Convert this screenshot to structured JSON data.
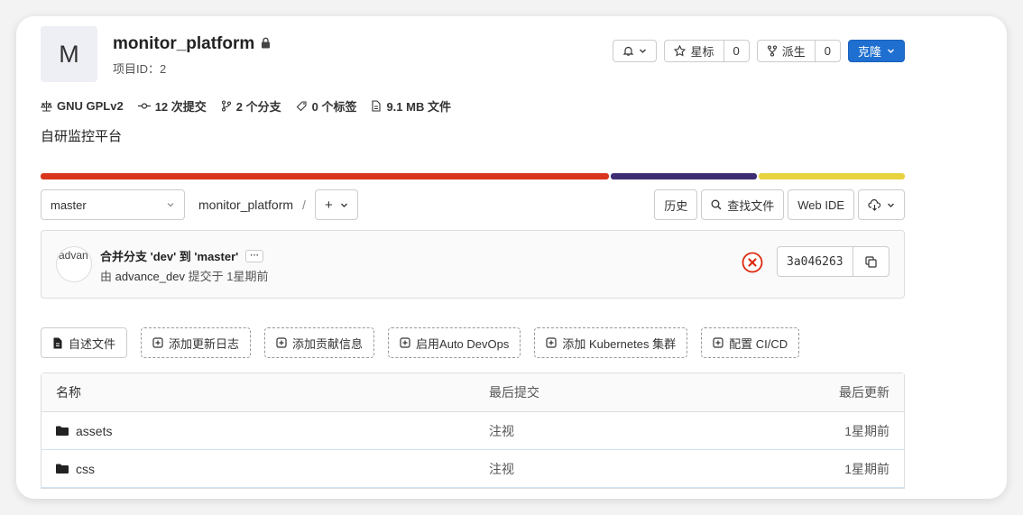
{
  "project": {
    "avatar_letter": "M",
    "name": "monitor_platform",
    "id_label": "项目ID：2",
    "description": "自研监控平台"
  },
  "actions": {
    "star_label": "星标",
    "star_count": "0",
    "fork_label": "派生",
    "fork_count": "0",
    "clone_label": "克隆"
  },
  "stats": {
    "license": "GNU GPLv2",
    "commits": "12 次提交",
    "branches": "2 个分支",
    "tags": "0 个标签",
    "files": "9.1 MB 文件"
  },
  "language_bar": {
    "colors": [
      "#d9341c",
      "#3f2d74",
      "#e8d33e"
    ],
    "fractions": [
      0.66,
      0.17,
      0.17
    ]
  },
  "branch_row": {
    "branch": "master",
    "path_root": "monitor_platform",
    "separator": "/",
    "plus": "+",
    "history": "历史",
    "find_file": "查找文件",
    "web_ide": "Web IDE"
  },
  "commit": {
    "avatar_alt": "advan",
    "title": "合并分支 'dev' 到 'master'",
    "ellipsis": "···",
    "meta_prefix": "由",
    "author": "advance_dev",
    "meta_suffix": "提交于 1星期前",
    "sha": "3a046263",
    "status_color": "#dd2b0e"
  },
  "quick_actions": [
    "自述文件",
    "添加更新日志",
    "添加贡献信息",
    "启用Auto DevOps",
    "添加 Kubernetes 集群",
    "配置 CI/CD"
  ],
  "table": {
    "headers": [
      "名称",
      "最后提交",
      "最后更新"
    ],
    "rows": [
      {
        "name": "assets",
        "commit": "注视",
        "updated": "1星期前"
      },
      {
        "name": "css",
        "commit": "注视",
        "updated": "1星期前"
      }
    ]
  }
}
